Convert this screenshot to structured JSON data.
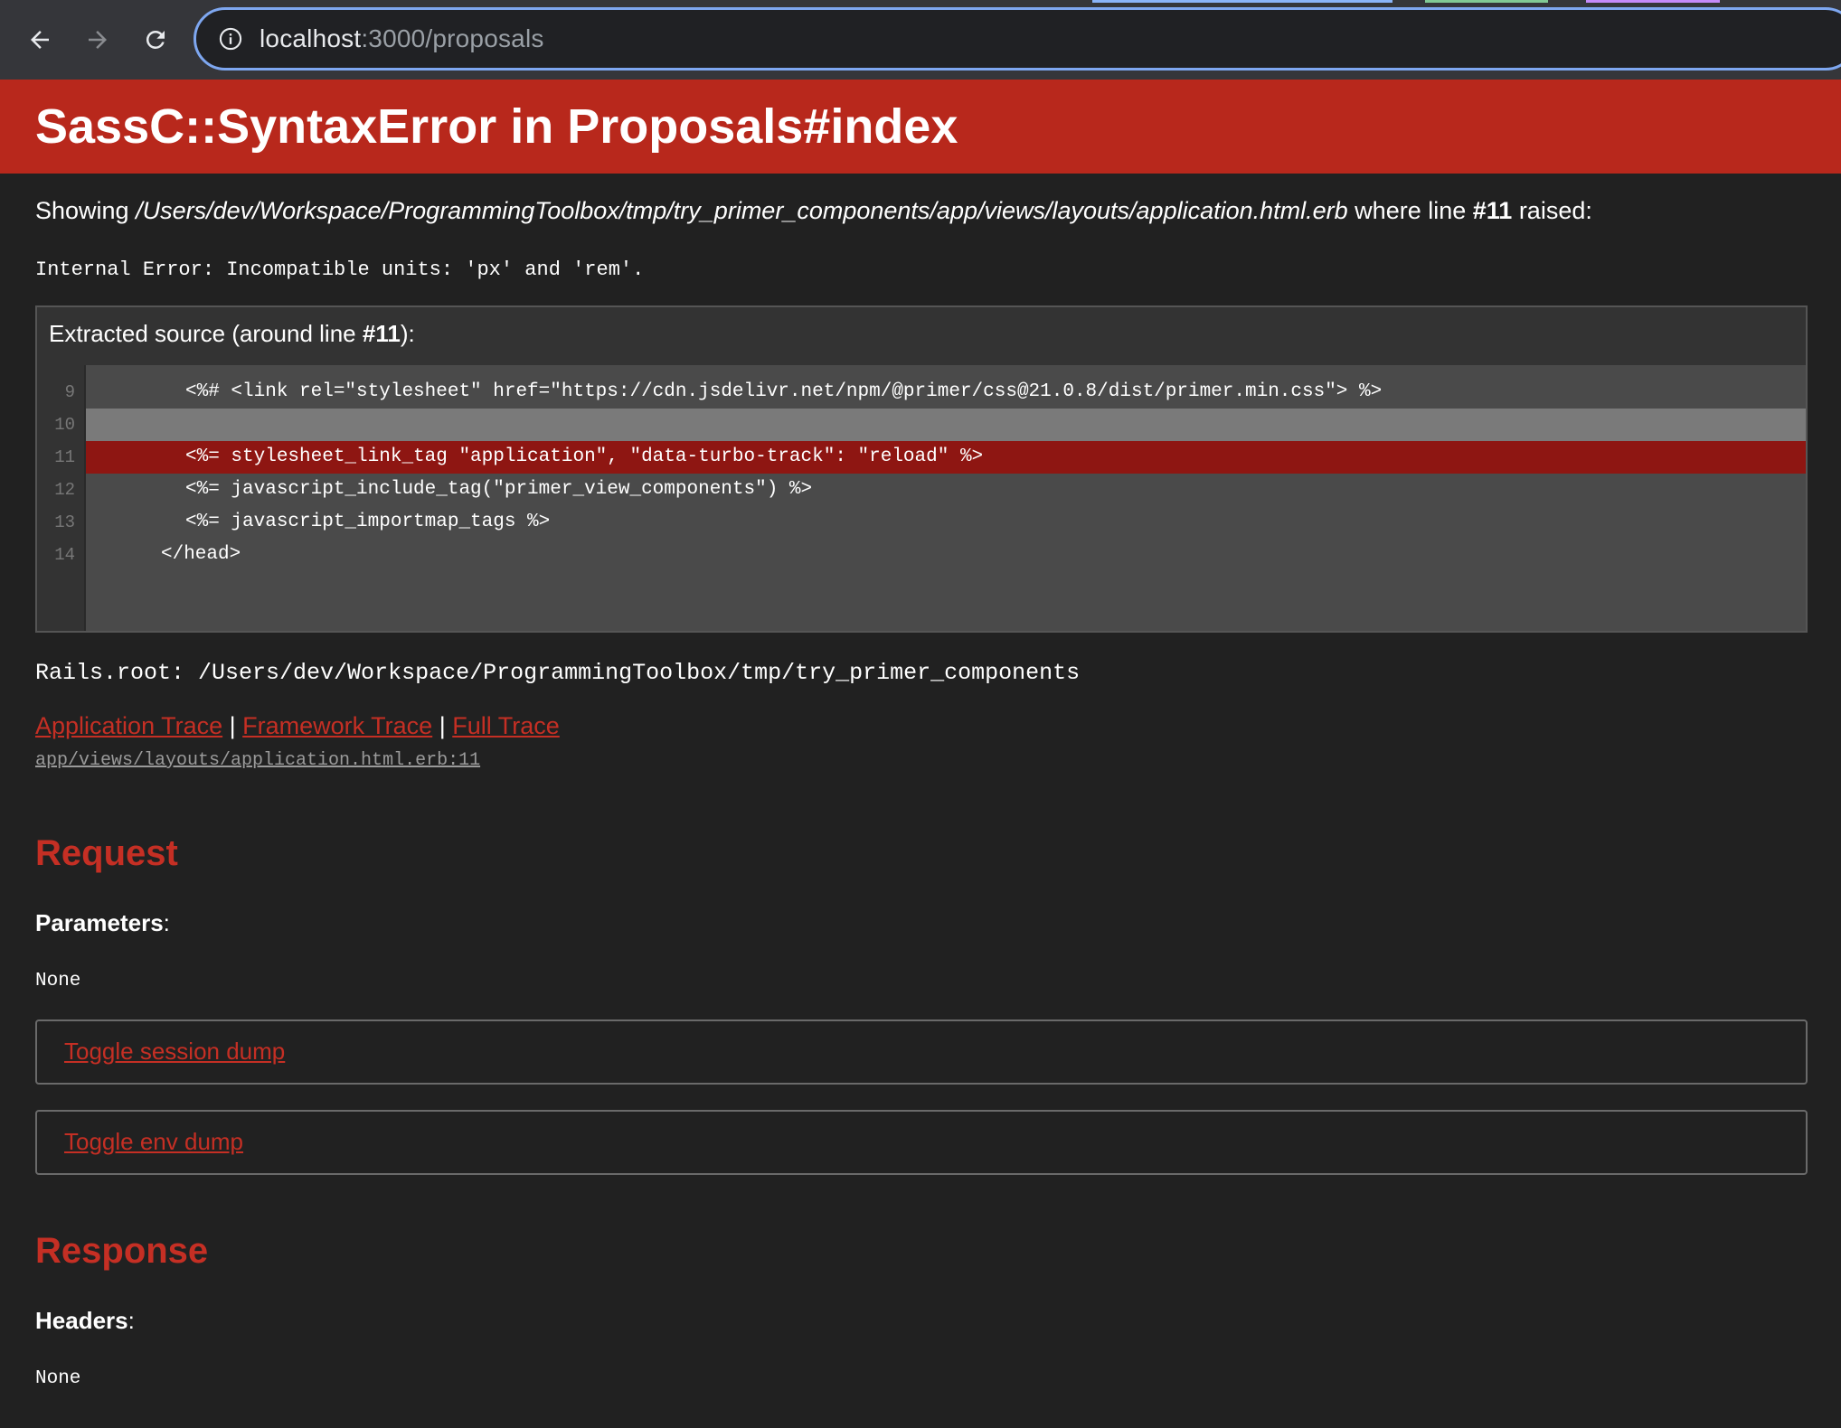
{
  "browser": {
    "url_host": "localhost",
    "url_path": ":3000/proposals"
  },
  "error": {
    "title": "SassC::SyntaxError in Proposals#index",
    "showing_prefix": "Showing ",
    "showing_file": "/Users/dev/Workspace/ProgrammingToolbox/tmp/try_primer_components/app/views/layouts/application.html.erb",
    "showing_mid": " where line ",
    "showing_line": "#11",
    "showing_suffix": " raised:",
    "message": "Internal Error: Incompatible units: 'px' and 'rem'."
  },
  "source": {
    "title_prefix": "Extracted source (around line ",
    "title_line": "#11",
    "title_suffix": "):",
    "lines": [
      {
        "num": "9",
        "text": "<%# <link rel=\"stylesheet\" href=\"https://cdn.jsdelivr.net/npm/@primer/css@21.0.8/dist/primer.min.css\"> %>"
      },
      {
        "num": "10",
        "text": ""
      },
      {
        "num": "11",
        "text": "<%= stylesheet_link_tag \"application\", \"data-turbo-track\": \"reload\" %>"
      },
      {
        "num": "12",
        "text": "<%= javascript_include_tag(\"primer_view_components\") %>"
      },
      {
        "num": "13",
        "text": "<%= javascript_importmap_tags %>"
      },
      {
        "num": "14",
        "text": "</head>"
      }
    ]
  },
  "rails_root": "Rails.root: /Users/dev/Workspace/ProgrammingToolbox/tmp/try_primer_components",
  "traces": {
    "application": "Application Trace",
    "framework": "Framework Trace",
    "full": "Full Trace",
    "separator": " | ",
    "file": "app/views/layouts/application.html.erb:11"
  },
  "request": {
    "heading": "Request",
    "params_label": "Parameters",
    "params_value": "None",
    "toggle_session": "Toggle session dump",
    "toggle_env": "Toggle env dump"
  },
  "response": {
    "heading": "Response",
    "headers_label": "Headers",
    "headers_value": "None"
  },
  "colors": {
    "header_red": "#b8281c",
    "link_red": "#c52f24",
    "error_line": "#8e1612",
    "background": "#212121"
  }
}
